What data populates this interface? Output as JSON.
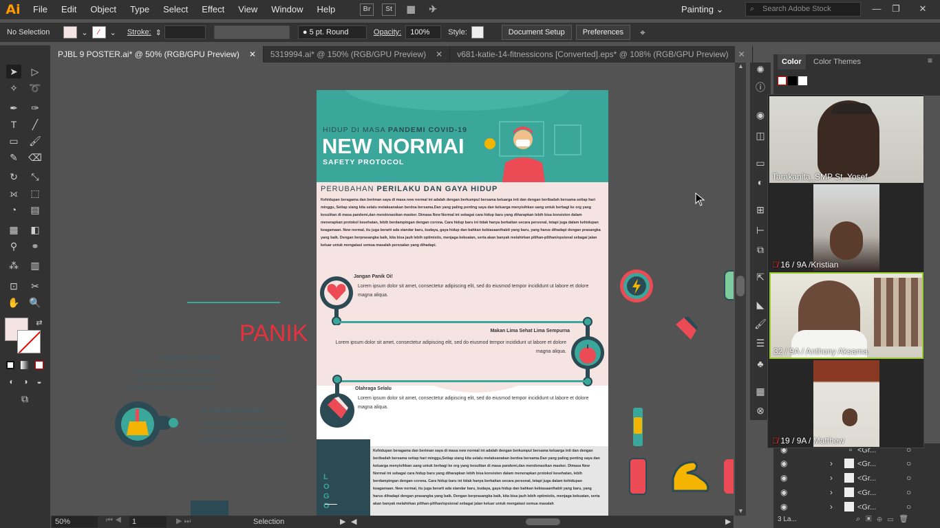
{
  "app": {
    "logo": "Ai",
    "workspace": "Painting",
    "search_placeholder": "Search Adobe Stock"
  },
  "menu": [
    "File",
    "Edit",
    "Object",
    "Type",
    "Select",
    "Effect",
    "View",
    "Window",
    "Help"
  ],
  "menu_icons": {
    "bridge": "Br",
    "stock": "St"
  },
  "control": {
    "selection": "No Selection",
    "stroke_label": "Stroke:",
    "brush": "5 pt. Round",
    "opacity_label": "Opacity:",
    "opacity": "100%",
    "style_label": "Style:",
    "doc_setup": "Document Setup",
    "preferences": "Preferences"
  },
  "tabs": [
    {
      "label": "PJBL 9 POSTER.ai* @ 50% (RGB/GPU Preview)"
    },
    {
      "label": "5319994.ai* @ 150% (RGB/GPU Preview)"
    },
    {
      "label": "v681-katie-14-fitnessicons [Converted].eps* @ 108% (RGB/GPU Preview)"
    }
  ],
  "status": {
    "zoom": "50%",
    "artboard": "1",
    "tool": "Selection"
  },
  "panels": {
    "color_tab": "Color",
    "themes_tab": "Color Themes",
    "layers_count": "3 La..."
  },
  "layers": [
    {
      "name": "<Gr..."
    },
    {
      "name": "<Gr..."
    },
    {
      "name": "<Gr..."
    },
    {
      "name": "<Gr..."
    },
    {
      "name": "<Gr..."
    }
  ],
  "poster": {
    "kicker": "HIDUP DI MASA ",
    "kicker_bold": "PANDEMI COVID-19",
    "title": "NEW NORMAI",
    "subtitle": "SAFETY PROTOCOL",
    "section": "PERUBAHAN ",
    "section_bold": "PERILAKU DAN GAYA HIDUP",
    "body": "Kehidupan beragama dan beriman saya di masa new normal ini adalah dengan berkumpul bersama keluarga inti dan dengan beribadah bersama setiap hari minggu, Setiap siang kita selalu melaksanakan berdoa bersama.Dan yang paling penting saya dan keluarga menyisihkan uang untuk berbagi ke org yang kesulitan di masa pandemi,dan mendonasikan masker. Dimasa New Normal ini sebagai cara hidup baru yang diharapkan lebih bisa konsisten dalam menerapkan protokol kesehatan, lebih berdampingan dengan corona. Cara hidup baru ini tidak hanya berkaitan secara personal, tetapi juga dalam kehidupan keagamaan. New normal, itu juga berarti ada standar baru, budaya, gaya hidup dan bahkan kebiasaan/habit yang baru, yang harus dihadapi dengan prasangka yang baik. Dengan berprasangka baik, kita bisa jauh lebih optimistis, menjaga kekuatan, serta akan banyak melahirkan pilihan-pilihan/opsional sebagai jalan keluar untuk mengatasi semua masalah persoalan yang dihadapi.",
    "item1_title": "Jangan Panik Oi!",
    "item2_title": "Makan Lima Sehat Lima Sempurna",
    "item3_title": "Olahraga Selalu",
    "lorem": "Lorem ipsum dolor sit amet, consectetur adipiscing elit, sed do eiusmod tempor incididunt ut labore et dolore magna aliqua.",
    "logo": "LOGO",
    "footer_body": "Kehidupan beragama dan beriman saya di masa new normal ini adalah dengan berkumpul bersama keluarga inti dan dengan beribadah bersama setiap hari minggu,Setiap siang kita selalu melaksanakan berdoa bersama.Dan yang paling penting saya dan keluarga menyisihkan uang untuk berbagi ke org yang kesulitan di masa pandemi,dan mendonasikan masker. Dimasa New Normal ini sebagai cara hidup baru yang diharapkan lebih bisa konsisten dalam menerapkan protokol kesehatan, lebih berdampingan dengan corona. Cara hidup baru ini tidak hanya berkaitan secara personal, tetapi juga dalam kehidupan keagamaan. New normal, itu juga berarti ada standar baru, budaya, gaya hidup dan bahkan kebiasaan/habit yang baru, yang harus dihadapi dengan prasangka yang baik. Dengan berprasangka baik, kita bisa jauh lebih optimistis, menjaga kekuatan, serta akan banyak melahirkan pilihan-pilihan/opsional sebagai jalan keluar untuk mengatasi semua masalah"
  },
  "canvas_extra": {
    "panik": "PANIK",
    "step4_title": "04. SANITIZE YOUR HANDS",
    "step5_title": "05. SCHEDULED CLEANING",
    "step_lorem": "Lorem ipsum dolor sit amet, consectetur adipiscing elit, sed do eiusmod tempor incididunt ut labore et dolore magna aliqua."
  },
  "participants": [
    {
      "name": "Tarakanita_SMP St. Yosef",
      "muted": false
    },
    {
      "name": "16 / 9A /Kristian",
      "muted": true
    },
    {
      "name": "32 / 9A / Anthony Aksama",
      "muted": false
    },
    {
      "name": "19 / 9A / Matthew",
      "muted": true
    }
  ],
  "colors": {
    "teal": "#3aa79a",
    "pink": "#f6e4e2",
    "dark": "#2b4a53",
    "red": "#ec4a55",
    "orange": "#ff9a00"
  }
}
